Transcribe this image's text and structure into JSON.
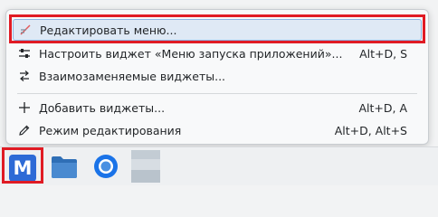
{
  "menu": {
    "items": [
      {
        "icon": "edit-menu-icon",
        "label": "Редактировать меню...",
        "shortcut": ""
      },
      {
        "icon": "configure-icon",
        "label": "Настроить виджет «Меню запуска приложений»...",
        "shortcut": "Alt+D, S"
      },
      {
        "icon": "switch-widgets-icon",
        "label": "Взаимозаменяемые виджеты...",
        "shortcut": ""
      },
      {
        "icon": "add-icon",
        "label": "Добавить виджеты...",
        "shortcut": "Alt+D, A"
      },
      {
        "icon": "edit-pencil-icon",
        "label": "Режим редактирования",
        "shortcut": "Alt+D, Alt+S"
      }
    ]
  },
  "taskbar": {
    "launcher_letter": "M",
    "apps": [
      "files-icon",
      "chromium-icon",
      "window-thumbnail-icon"
    ]
  },
  "colors": {
    "highlight_bg": "#dfe9f5",
    "highlight_border": "#8cb4e3",
    "annotation_red": "#e01b24",
    "launcher_blue": "#2d6ad6"
  }
}
